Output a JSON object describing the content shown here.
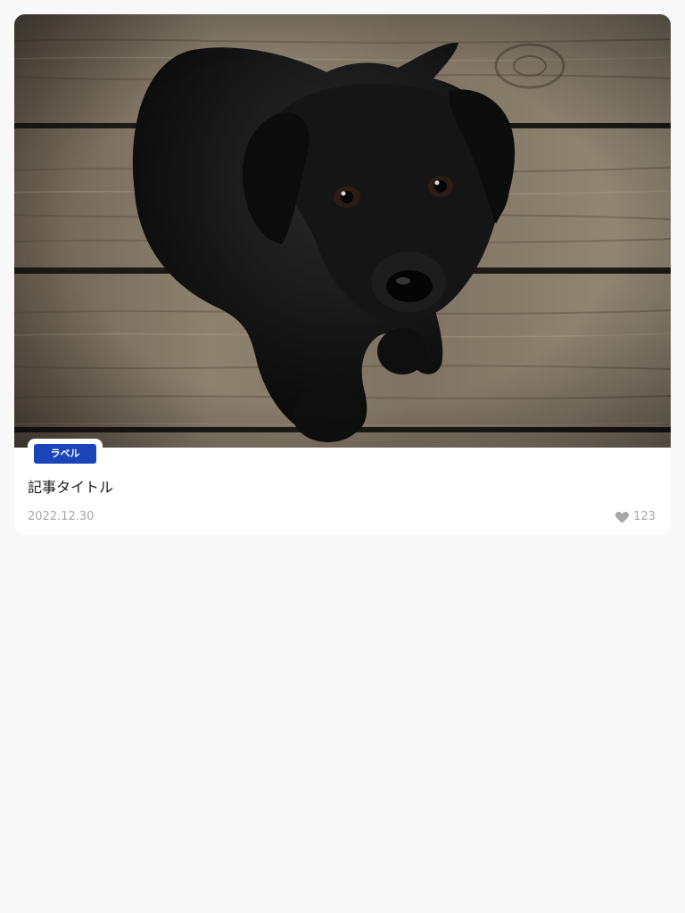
{
  "card": {
    "image_subject": "black puppy on wooden floor",
    "label": "ラベル",
    "title": "記事タイトル",
    "date": "2022.12.30",
    "likes": "123",
    "like_icon": "heart-icon",
    "colors": {
      "label_bg": "#1a44b8",
      "meta_text": "#a6a6a6",
      "title_text": "#1c1c1c",
      "page_bg": "#f8f8f8"
    }
  }
}
